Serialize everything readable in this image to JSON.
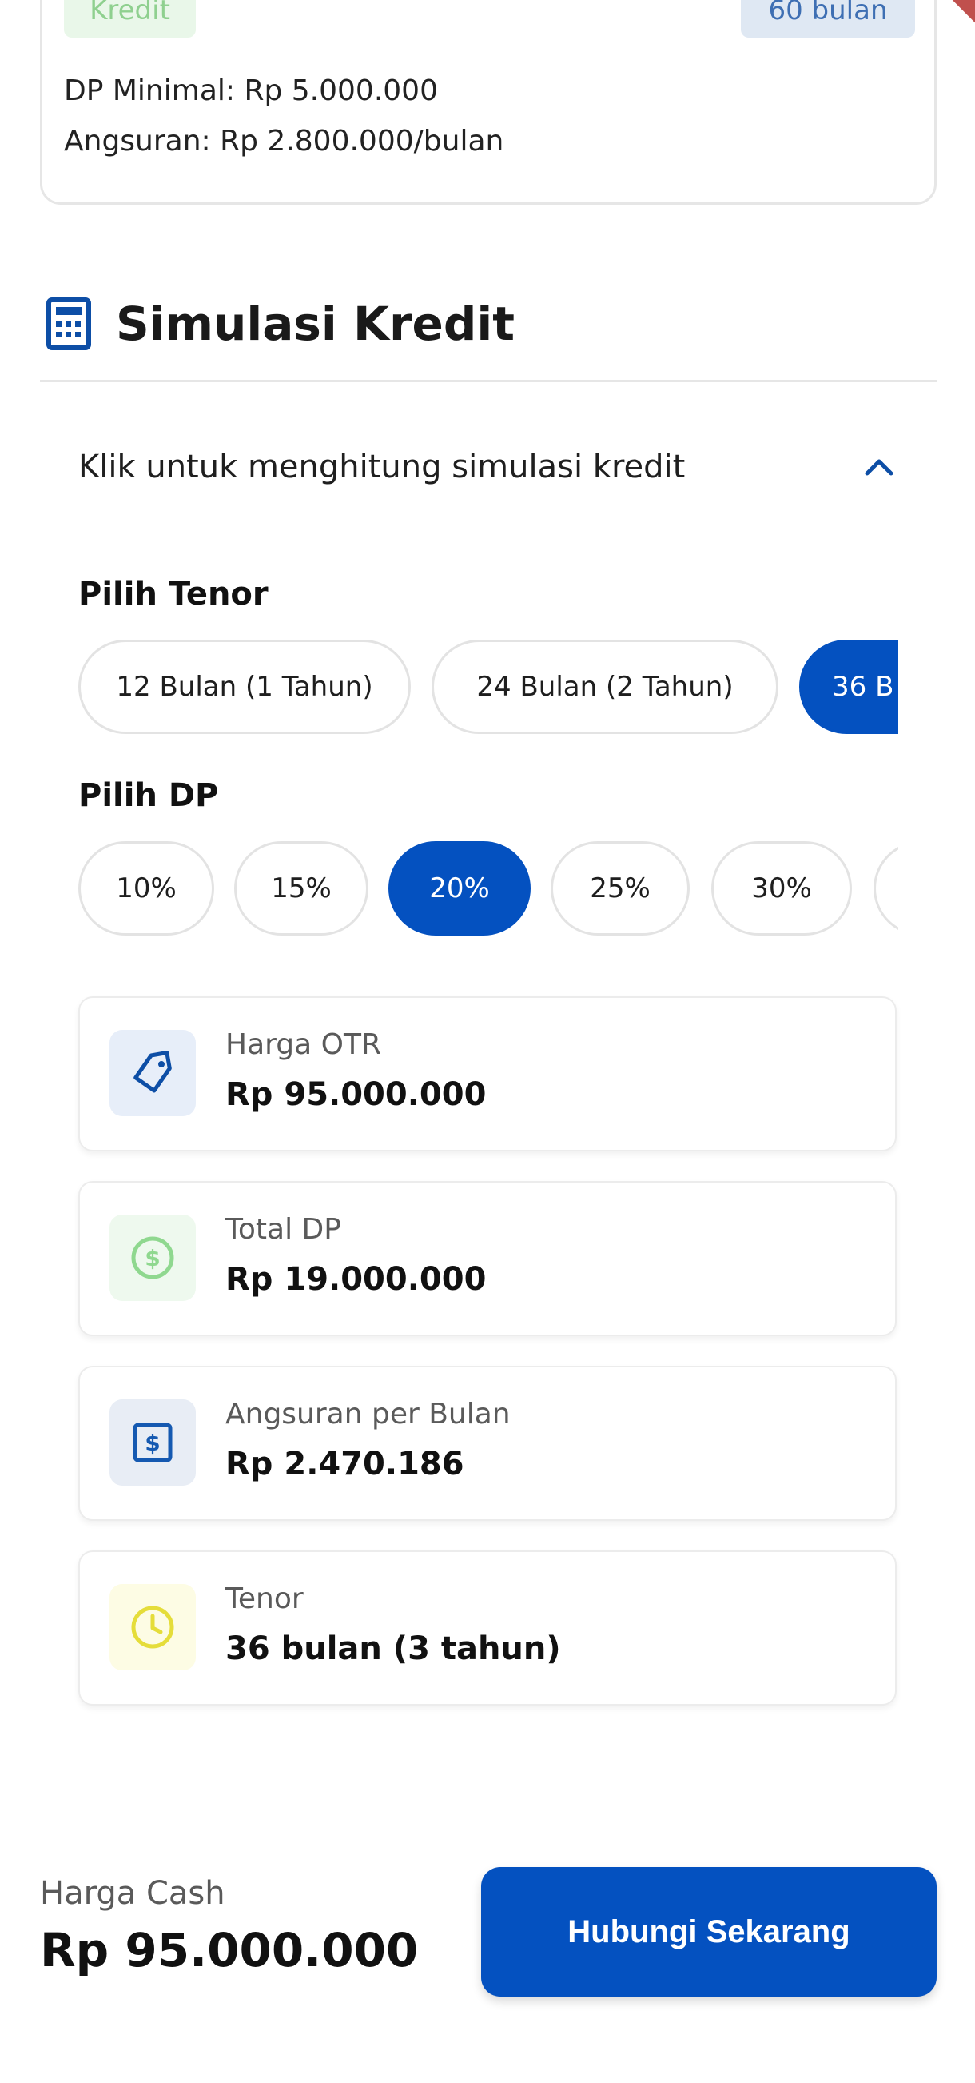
{
  "top_card": {
    "badge_left": "Kredit",
    "badge_right": "60 bulan",
    "dp_min": "DP Minimal: Rp 5.000.000",
    "angsuran": "Angsuran: Rp 2.800.000/bulan"
  },
  "section": {
    "title": "Simulasi Kredit",
    "accordion_text": "Klik untuk menghitung simulasi kredit"
  },
  "tenor": {
    "label": "Pilih Tenor",
    "options": [
      "12 Bulan (1 Tahun)",
      "24 Bulan (2 Tahun)",
      "36 B"
    ],
    "selected_index": 2
  },
  "dp": {
    "label": "Pilih DP",
    "options": [
      "10%",
      "15%",
      "20%",
      "25%",
      "30%",
      ""
    ],
    "selected_index": 2
  },
  "cards": [
    {
      "label": "Harga OTR",
      "value": "Rp 95.000.000",
      "icon": "tag-icon",
      "icon_color": "#0d4ea6",
      "icon_bg": "#e7eef9"
    },
    {
      "label": "Total DP",
      "value": "Rp 19.000.000",
      "icon": "dollar-circle-icon",
      "icon_color": "#8fd88f",
      "icon_bg": "#eef9ee"
    },
    {
      "label": "Angsuran per Bulan",
      "value": "Rp 2.470.186",
      "icon": "dollar-square-icon",
      "icon_color": "#1559b1",
      "icon_bg": "#e8edf5"
    },
    {
      "label": "Tenor",
      "value": "36 bulan (3 tahun)",
      "icon": "clock-icon",
      "icon_color": "#e5dd3a",
      "icon_bg": "#fdfce4"
    }
  ],
  "footer": {
    "label": "Harga Cash",
    "price": "Rp 95.000.000",
    "button": "Hubungi Sekarang"
  },
  "colors": {
    "primary": "#0451c0",
    "border": "#e3e3e3"
  }
}
